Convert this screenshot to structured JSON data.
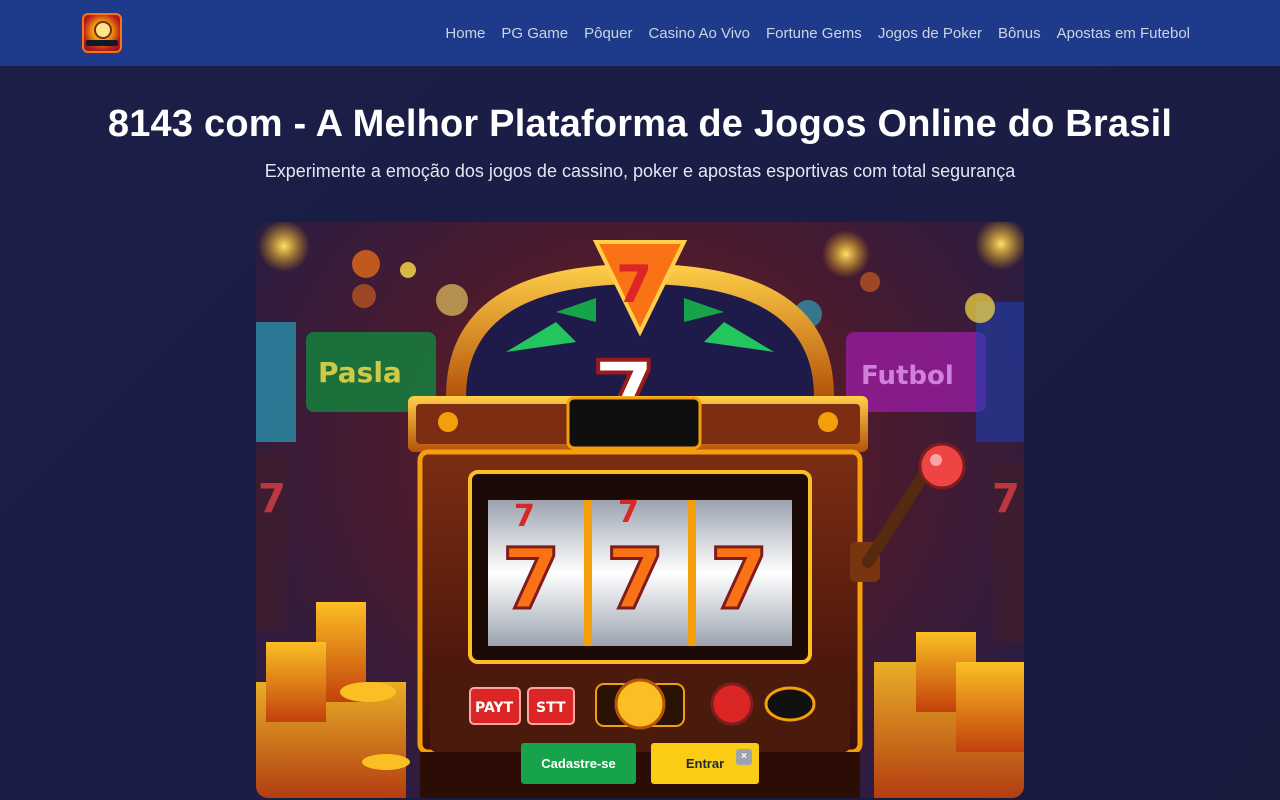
{
  "header": {
    "logo_alt": "8143 com logo",
    "nav": [
      {
        "label": "Home"
      },
      {
        "label": "PG Game"
      },
      {
        "label": "Pôquer"
      },
      {
        "label": "Casino Ao Vivo"
      },
      {
        "label": "Fortune Gems"
      },
      {
        "label": "Jogos de Poker"
      },
      {
        "label": "Bônus"
      },
      {
        "label": "Apostas em Futebol"
      }
    ]
  },
  "hero": {
    "title": "8143 com - A Melhor Plataforma de Jogos Online do Brasil",
    "subtitle": "Experimente a emoção dos jogos de cassino, poker e apostas esportivas com total segurança",
    "image_alt": "Slot machine with triple seven",
    "slot_buttons": [
      "PAYT",
      "STT"
    ]
  },
  "cta": {
    "register_label": "Cadastre-se",
    "login_label": "Entrar",
    "close_symbol": "×"
  },
  "colors": {
    "header_bg": "#1e3a8a",
    "page_bg": "#1b1f47",
    "register": "#16a34a",
    "login": "#facc15"
  }
}
